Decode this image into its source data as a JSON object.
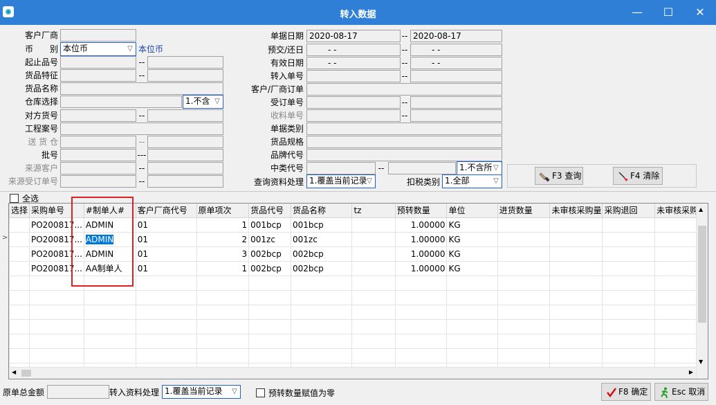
{
  "window": {
    "title": "转入数据",
    "minimize": "—",
    "maximize": "☐",
    "close": "✕"
  },
  "form": {
    "customer_label": "客户厂商",
    "currency_label": "币　　别",
    "currency_value": "本位币",
    "currency_text": "本位币",
    "start_item_label": "起止品号",
    "item_feature_label": "货品特征",
    "item_name_label": "货品名称",
    "warehouse_label": "仓库选择",
    "warehouse_option": "1.不含",
    "counter_item_label": "对方货号",
    "project_label": "工程案号",
    "ship_warehouse_label": "送 货 仓",
    "batch_label": "批号",
    "source_customer_label": "来源客户",
    "source_order_label": "来源受订单号",
    "doc_date_label": "单据日期",
    "doc_date_from": "2020-08-17",
    "doc_date_to": "2020-08-17",
    "delivery_date_label": "预交/还日",
    "date_empty": "-  -",
    "valid_date_label": "有效日期",
    "transfer_no_label": "转入单号",
    "customer_order_label": "客户/厂商订单",
    "sales_order_label": "受订单号",
    "receipt_no_label": "收料单号",
    "doc_type_label": "单据类别",
    "spec_label": "货品规格",
    "brand_label": "品牌代号",
    "category_label": "中类代号",
    "category_option": "1.不含所",
    "query_proc_label": "查询资料处理",
    "query_proc_value": "1.覆盖当前记录",
    "tax_label": "扣税类别",
    "tax_value": "1.全部",
    "dash": "--",
    "dash3": "---"
  },
  "buttons": {
    "query": "F3 查询",
    "clear": "F4 清除",
    "confirm": "F8 确定",
    "cancel": "Esc 取消"
  },
  "select_all": "全选",
  "grid": {
    "columns": [
      "选择",
      "采购单号",
      "#制单人#",
      "客户厂商代号",
      "原单项次",
      "货品代号",
      "货品名称",
      "tz",
      "预转数量",
      "单位",
      "进货数量",
      "未审核采购量",
      "采购退回",
      "未审核采购"
    ],
    "rows": [
      {
        "po": "PO200817...",
        "maker": "ADMIN",
        "cust": "01",
        "seq": "1",
        "code": "001bcp",
        "name": "001bcp",
        "qty": "1.00000",
        "unit": "KG"
      },
      {
        "po": "PO200817...",
        "maker": "ADMIN",
        "cust": "01",
        "seq": "2",
        "code": "001zc",
        "name": "001zc",
        "qty": "1.00000",
        "unit": "KG"
      },
      {
        "po": "PO200817...",
        "maker": "ADMIN",
        "cust": "01",
        "seq": "3",
        "code": "002bcp",
        "name": "002bcp",
        "qty": "1.00000",
        "unit": "KG"
      },
      {
        "po": "PO200817...",
        "maker": "AA制单人",
        "cust": "01",
        "seq": "1",
        "code": "002bcp",
        "name": "002bcp",
        "qty": "1.00000",
        "unit": "KG"
      }
    ]
  },
  "footer": {
    "total_label": "原单总金额",
    "transfer_proc_label": "转入资料处理",
    "transfer_proc_value": "1.覆盖当前记录",
    "zero_label": "预转数量赋值为零"
  }
}
